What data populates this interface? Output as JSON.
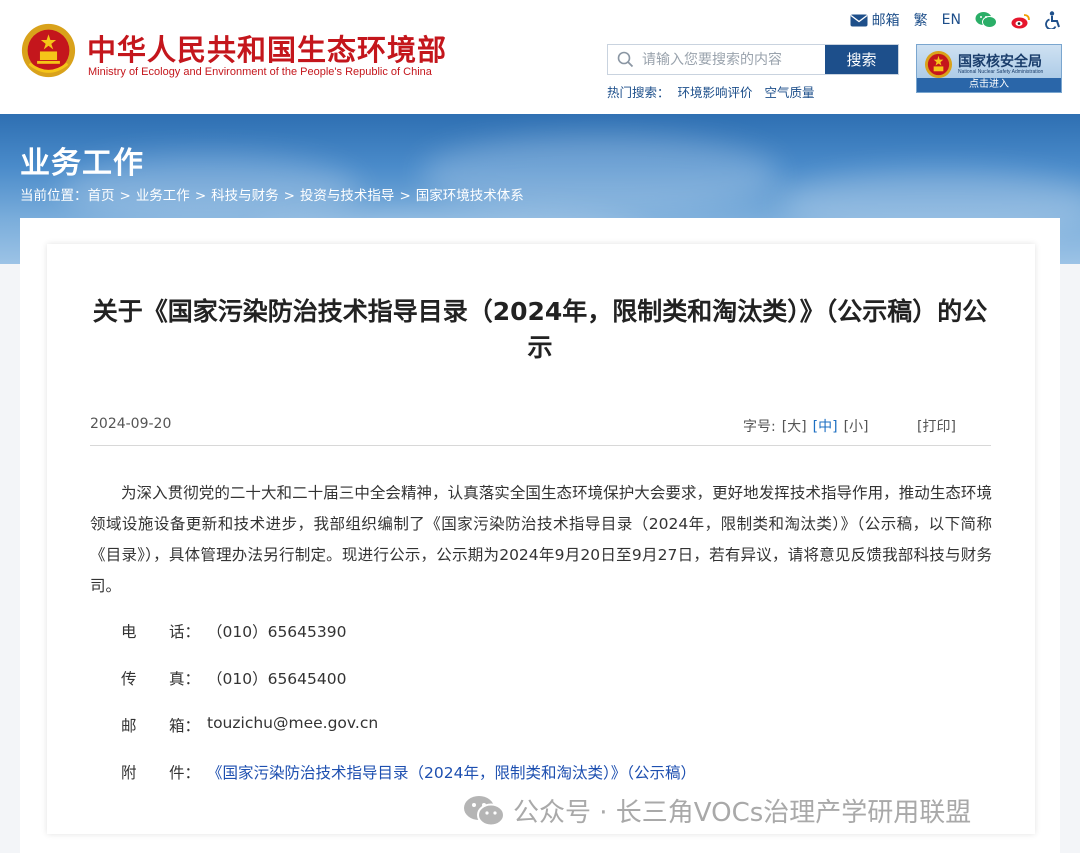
{
  "header": {
    "title_cn": "中华人民共和国生态环境部",
    "title_en": "Ministry of Ecology and Environment of the People's Republic of China",
    "top_links": {
      "mail": "邮箱",
      "traditional": "繁",
      "english": "EN"
    },
    "search": {
      "placeholder": "请输入您要搜索的内容",
      "button": "搜索"
    },
    "hot_search": {
      "label": "热门搜索：",
      "items": [
        "环境影响评价",
        "空气质量"
      ]
    },
    "nnsa": {
      "title": "国家核安全局",
      "subtitle": "National Nuclear Safety Administration",
      "enter": "点击进入"
    }
  },
  "banner": {
    "section_title": "业务工作",
    "breadcrumb": [
      "当前位置：",
      "首页",
      "业务工作",
      "科技与财务",
      "投资与技术指导",
      "国家环境技术体系"
    ]
  },
  "article": {
    "title": "关于《国家污染防治技术指导目录（2024年，限制类和淘汰类）》（公示稿）的公示",
    "date": "2024-09-20",
    "font_size": {
      "label": "字号:",
      "large": "[大]",
      "medium": "[中]",
      "small": "[小]"
    },
    "print": "[打印]",
    "paragraph": "为深入贯彻党的二十大和二十届三中全会精神，认真落实全国生态环境保护大会要求，更好地发挥技术指导作用，推动生态环境领域设施设备更新和技术进步，我部组织编制了《国家污染防治技术指导目录（2024年，限制类和淘汰类）》（公示稿，以下简称《目录》），具体管理办法另行制定。现进行公示，公示期为2024年9月20日至9月27日，若有异议，请将意见反馈我部科技与财务司。",
    "contacts": [
      {
        "k1": "电",
        "k2": "话：",
        "value": "（010）65645390"
      },
      {
        "k1": "传",
        "k2": "真：",
        "value": "（010）65645400"
      },
      {
        "k1": "邮",
        "k2": "箱：",
        "value": "touzichu@mee.gov.cn"
      },
      {
        "k1": "附",
        "k2": "件：",
        "value": "《国家污染防治技术指导目录（2024年，限制类和淘汰类）》（公示稿）"
      }
    ]
  },
  "watermark": "公众号 · 长三角VOCs治理产学研用联盟",
  "colors": {
    "brand_red": "#c4161c",
    "nav_blue": "#1d4f8b",
    "link_blue": "#1d4fb0"
  }
}
